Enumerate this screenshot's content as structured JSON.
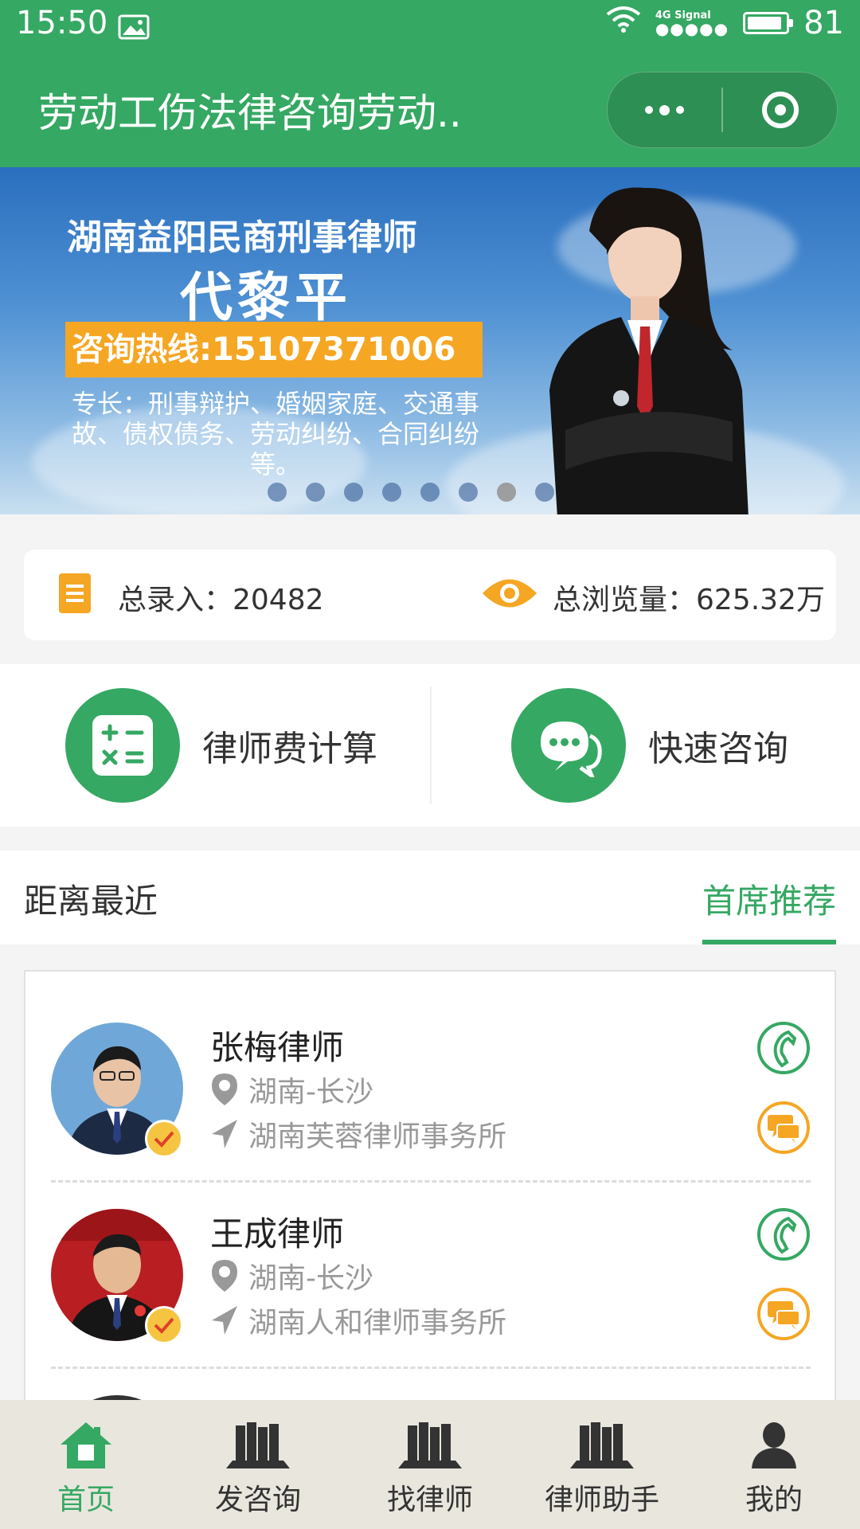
{
  "status_bar": {
    "time": "15:50",
    "network": "4G",
    "signal_label": "Signal",
    "signal_dots": "●●●●●",
    "battery": "81",
    "battery_level": 0.81
  },
  "nav": {
    "title": "劳动工伤法律咨询劳动.."
  },
  "banner": {
    "line1": "湖南益阳民商刑事律师",
    "name": "代黎平",
    "hotline": "咨询热线:15107371006",
    "specialty": "专长：刑事辩护、婚姻家庭、交通事故、债权债务、劳动纠纷、合同纠纷等。",
    "slide_count": 8,
    "active_slide": 6
  },
  "stats": {
    "total_entries": "总录入：20482",
    "total_views": "总浏览量：625.32万"
  },
  "quick_actions": [
    {
      "label": "律师费计算",
      "icon": "calculator-icon"
    },
    {
      "label": "快速咨询",
      "icon": "chat-bubbles-icon"
    }
  ],
  "tabs": {
    "nearest": "距离最近",
    "featured": "首席推荐",
    "active": "featured"
  },
  "lawyers": [
    {
      "name": "张梅律师",
      "location": "湖南-长沙",
      "firm": "湖南芙蓉律师事务所"
    },
    {
      "name": "王成律师",
      "location": "湖南-长沙",
      "firm": "湖南人和律师事务所"
    }
  ],
  "bottom_nav": [
    {
      "label": "首页",
      "icon": "home-icon",
      "active": true
    },
    {
      "label": "发咨询",
      "icon": "books-icon",
      "active": false
    },
    {
      "label": "找律师",
      "icon": "books-icon",
      "active": false
    },
    {
      "label": "律师助手",
      "icon": "books-icon",
      "active": false
    },
    {
      "label": "我的",
      "icon": "person-icon",
      "active": false
    }
  ],
  "colors": {
    "brand_green": "#35a863",
    "accent_orange": "#f5a623",
    "tab_bar_bg": "#e9e6dd"
  }
}
